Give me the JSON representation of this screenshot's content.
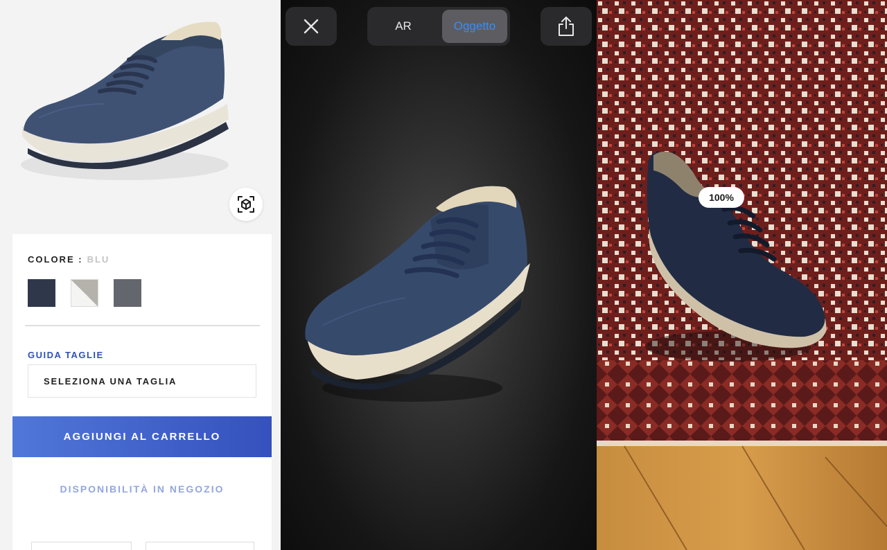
{
  "product_page": {
    "color_label": "COLORE :",
    "color_value": "BLU",
    "swatches": [
      {
        "name": "navy",
        "color": "#2f384b"
      },
      {
        "name": "white-grey",
        "color": "#f4f4f2"
      },
      {
        "name": "grey",
        "color": "#63666c"
      }
    ],
    "size_guide_label": "GUIDA TAGLIE",
    "size_select_placeholder": "SELEZIONA UNA TAGLIA",
    "add_to_cart_label": "AGGIUNGI AL CARRELLO",
    "store_availability_label": "DISPONIBILITÀ IN NEGOZIO",
    "accent_color": "#3a56c0",
    "ar_button_icon": "ar-cube-icon"
  },
  "viewer": {
    "close_icon": "close-icon",
    "share_icon": "share-icon",
    "mode_options": [
      "AR",
      "Oggetto"
    ],
    "selected_mode": "Oggetto"
  },
  "ar_view": {
    "scale_label": "100%"
  }
}
